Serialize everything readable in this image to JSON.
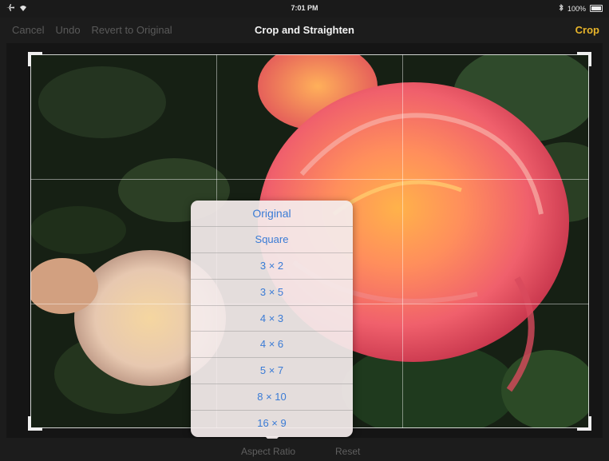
{
  "status_bar": {
    "time": "7:01 PM",
    "battery_percent": "100%",
    "icons": [
      "airplane-icon",
      "wifi-icon",
      "bluetooth-icon",
      "battery-icon"
    ]
  },
  "nav": {
    "cancel": "Cancel",
    "undo": "Undo",
    "revert": "Revert to Original",
    "title": "Crop and Straighten",
    "crop": "Crop"
  },
  "aspect_ratio_menu": {
    "options": [
      "Original",
      "Square",
      "3 × 2",
      "3 × 5",
      "4 × 3",
      "4 × 6",
      "5 × 7",
      "8 × 10",
      "16 × 9"
    ]
  },
  "toolbar": {
    "aspect_ratio": "Aspect Ratio",
    "reset": "Reset"
  },
  "colors": {
    "accent_crop": "#e8b52a",
    "menu_text": "#3a7bd5",
    "disabled_text": "#5a5a5a"
  }
}
